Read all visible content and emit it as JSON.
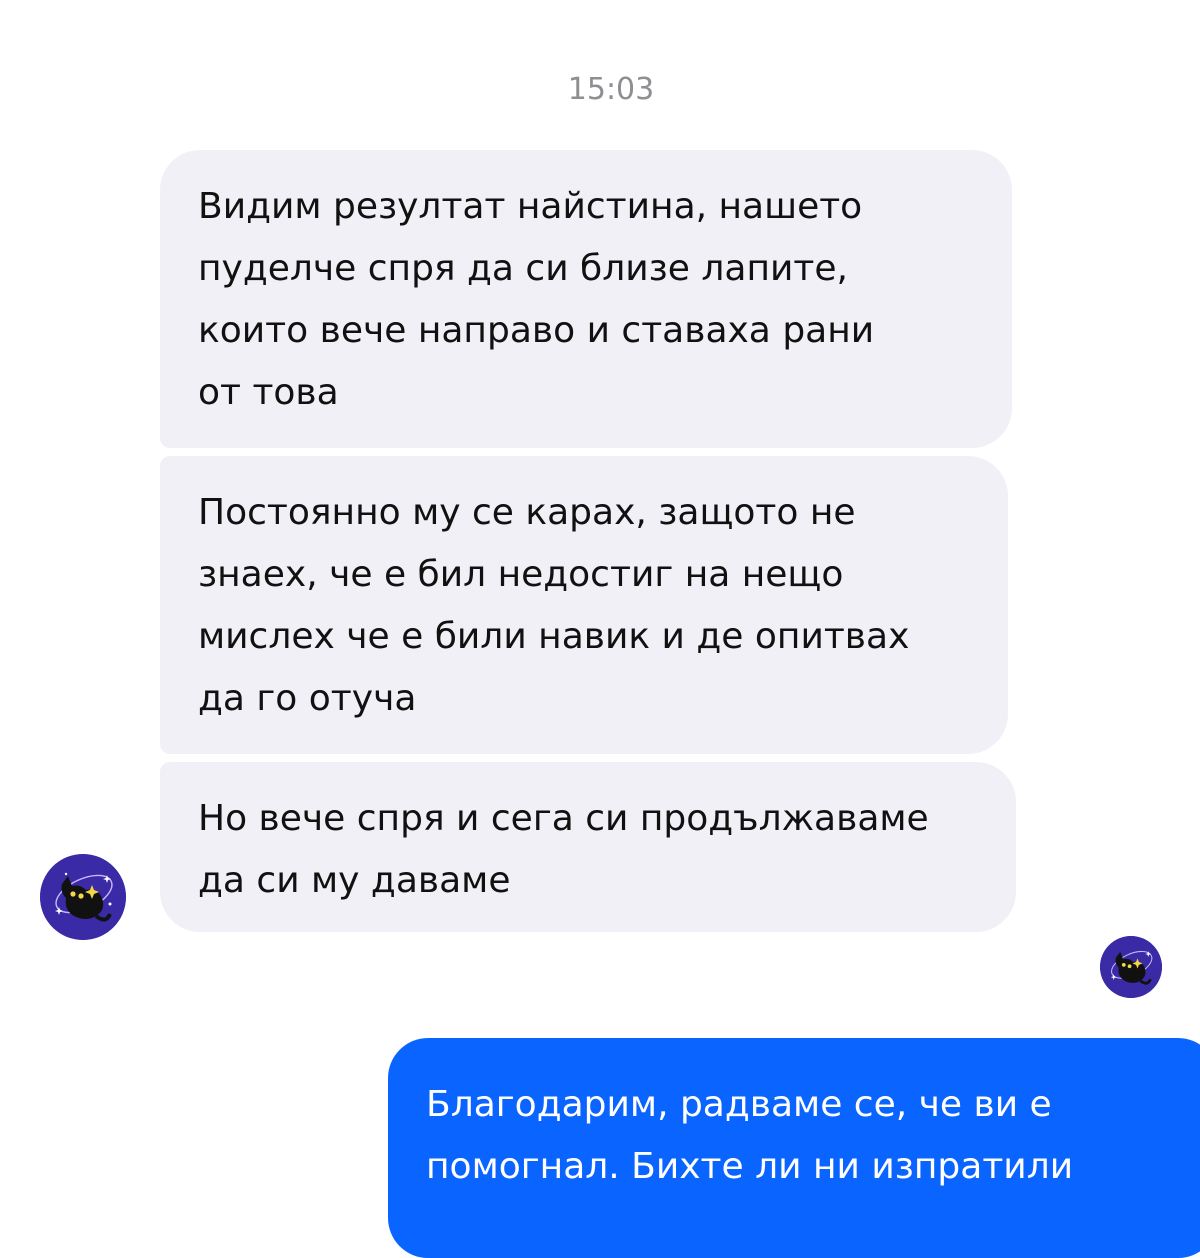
{
  "chat": {
    "timestamp": "15:03",
    "messages": [
      {
        "direction": "incoming",
        "text": "Видим резултат найстина, нашето\nпуделче спря да си близе лапите,\nкоито вече направо и ставаха рани\nот това"
      },
      {
        "direction": "incoming",
        "text": "Постоянно му се карах, защото не\nзнаех, че е бил недостиг на нещо\nмислех че е били навик и де опитвах\nда го отуча"
      },
      {
        "direction": "incoming",
        "text": "Но вече спря и сега си продължаваме\nда си му даваме"
      },
      {
        "direction": "outgoing",
        "text": "Благодарим, радваме се, че ви е\nпомогнал. Бихте ли ни изпратили"
      }
    ]
  },
  "avatars": {
    "contact_icon": "black-cat-icon",
    "read_receipt_icon": "black-cat-icon"
  },
  "colors": {
    "incoming_bubble": "#f0f0f6",
    "outgoing_bubble": "#0a64ff",
    "avatar_background": "#3b2aa6",
    "timestamp_text": "#8e8e93"
  }
}
